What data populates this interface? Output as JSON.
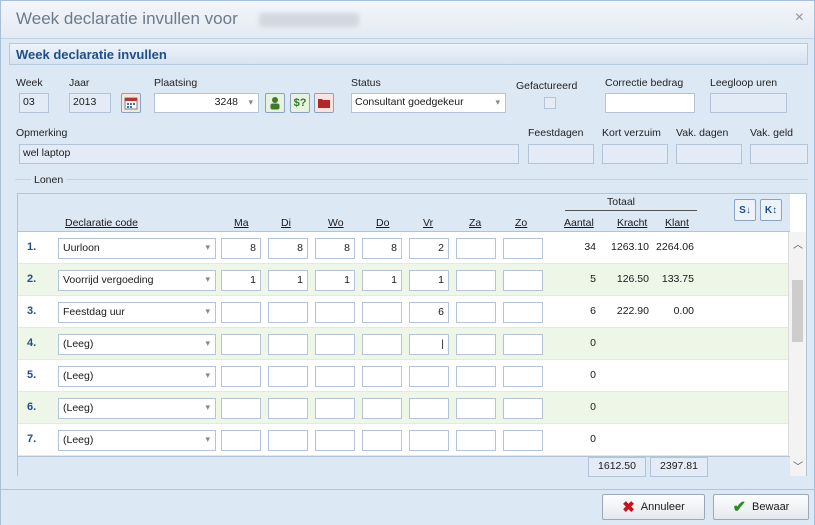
{
  "window": {
    "title": "Week declaratie invullen voor",
    "close_icon": "×"
  },
  "header": {
    "title": "Week declaratie invullen"
  },
  "form": {
    "week_label": "Week",
    "week_value": "03",
    "jaar_label": "Jaar",
    "jaar_value": "2013",
    "plaatsing_label": "Plaatsing",
    "plaatsing_value": "3248",
    "status_label": "Status",
    "status_value": "Consultant goedgekeur",
    "gefactureerd_label": "Gefactureerd",
    "correctie_label": "Correctie bedrag",
    "leegloop_label": "Leegloop uren",
    "opmerking_label": "Opmerking",
    "opmerking_value": "wel laptop",
    "feestdagen_label": "Feestdagen",
    "kort_verzuim_label": "Kort verzuim",
    "vak_dagen_label": "Vak. dagen",
    "vak_geld_label": "Vak. geld"
  },
  "lonen": {
    "group_label": "Lonen",
    "totaal_label": "Totaal",
    "headers": {
      "code": "Declaratie code",
      "ma": "Ma",
      "di": "Di",
      "wo": "Wo",
      "do": "Do",
      "vr": "Vr",
      "za": "Za",
      "zo": "Zo",
      "aantal": "Aantal",
      "kracht": "Kracht",
      "klant": "Klant"
    },
    "rows": [
      {
        "num": "1.",
        "code": "Uurloon",
        "ma": "8",
        "di": "8",
        "wo": "8",
        "do": "8",
        "vr": "2",
        "za": "",
        "zo": "",
        "aantal": "34",
        "kracht": "1263.10",
        "klant": "2264.06"
      },
      {
        "num": "2.",
        "code": "Voorrijd vergoeding",
        "ma": "1",
        "di": "1",
        "wo": "1",
        "do": "1",
        "vr": "1",
        "za": "",
        "zo": "",
        "aantal": "5",
        "kracht": "126.50",
        "klant": "133.75"
      },
      {
        "num": "3.",
        "code": "Feestdag uur",
        "ma": "",
        "di": "",
        "wo": "",
        "do": "",
        "vr": "6",
        "za": "",
        "zo": "",
        "aantal": "6",
        "kracht": "222.90",
        "klant": "0.00"
      },
      {
        "num": "4.",
        "code": "(Leeg)",
        "ma": "",
        "di": "",
        "wo": "",
        "do": "",
        "vr": "|",
        "za": "",
        "zo": "",
        "aantal": "0",
        "kracht": "",
        "klant": ""
      },
      {
        "num": "5.",
        "code": "(Leeg)",
        "ma": "",
        "di": "",
        "wo": "",
        "do": "",
        "vr": "",
        "za": "",
        "zo": "",
        "aantal": "0",
        "kracht": "",
        "klant": ""
      },
      {
        "num": "6.",
        "code": "(Leeg)",
        "ma": "",
        "di": "",
        "wo": "",
        "do": "",
        "vr": "",
        "za": "",
        "zo": "",
        "aantal": "0",
        "kracht": "",
        "klant": ""
      },
      {
        "num": "7.",
        "code": "(Leeg)",
        "ma": "",
        "di": "",
        "wo": "",
        "do": "",
        "vr": "",
        "za": "",
        "zo": "",
        "aantal": "0",
        "kracht": "",
        "klant": ""
      }
    ],
    "total_kracht": "1612.50",
    "total_klant": "2397.81"
  },
  "buttons": {
    "annuleer": "Annuleer",
    "bewaar": "Bewaar"
  },
  "colors": {
    "accent": "#1f4f8a",
    "panel": "#dde8f5",
    "alt_row": "#eef6e8"
  }
}
